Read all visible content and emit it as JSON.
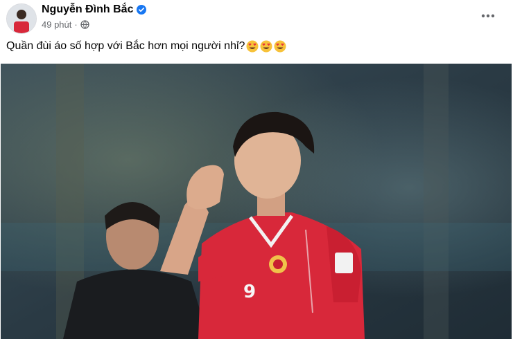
{
  "post": {
    "author": "Nguyễn Đình Bắc",
    "time": "49 phút",
    "separator": "·",
    "caption": "Quần đùi áo số hợp với Bắc hơn mọi người nhỉ?",
    "reaction_emojis": [
      "star-struck-emoji",
      "star-struck-emoji",
      "star-struck-emoji"
    ],
    "photo": {
      "jersey_number": "9",
      "description_icon": "football-player-photo"
    }
  },
  "colors": {
    "verified": "#1877f2",
    "meta_text": "#65676b",
    "jersey_red": "#d8283a",
    "emoji_face": "#f7c23a",
    "emoji_heart": "#e8323c"
  },
  "icons": {
    "verified": "verified-badge-icon",
    "privacy": "globe-icon",
    "more": "more-options-icon"
  }
}
